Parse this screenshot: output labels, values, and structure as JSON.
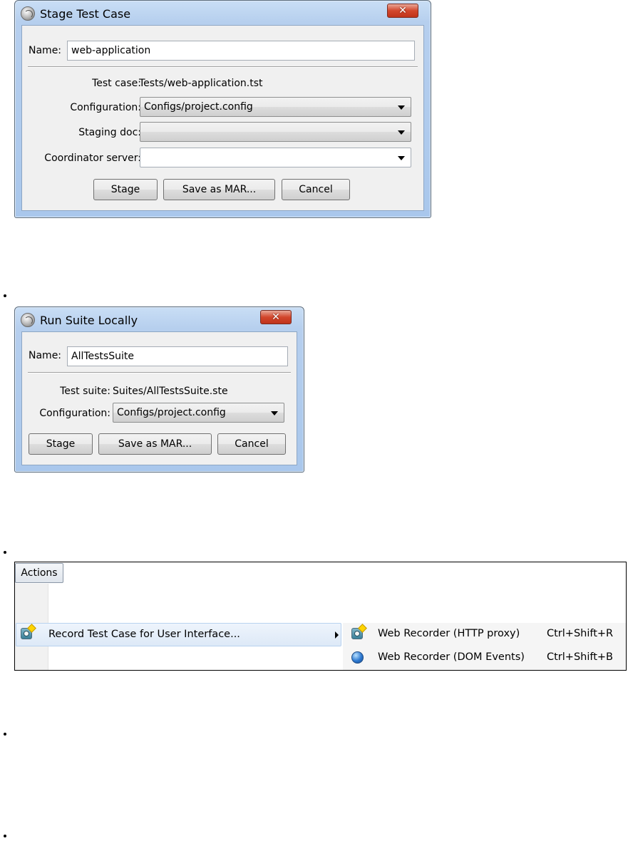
{
  "stage_dialog": {
    "title": "Stage Test Case",
    "close_label": "✕",
    "name_label": "Name:",
    "name_value": "web-application",
    "test_case_label": "Test case:",
    "test_case_value": "Tests/web-application.tst",
    "configuration_label": "Configuration:",
    "configuration_value": "Configs/project.config",
    "staging_doc_label": "Staging doc:",
    "staging_doc_value": "",
    "coordinator_label": "Coordinator server:",
    "coordinator_value": "",
    "buttons": {
      "stage": "Stage",
      "save_mar": "Save as MAR...",
      "cancel": "Cancel"
    }
  },
  "run_dialog": {
    "title": "Run Suite Locally",
    "close_label": "✕",
    "name_label": "Name:",
    "name_value": "AllTestsSuite",
    "test_suite_label": "Test suite:",
    "test_suite_value": "Suites/AllTestsSuite.ste",
    "configuration_label": "Configuration:",
    "configuration_value": "Configs/project.config",
    "buttons": {
      "stage": "Stage",
      "save_mar": "Save as MAR...",
      "cancel": "Cancel"
    }
  },
  "actions_menu": {
    "menu_label": "Actions",
    "item_label": "Record Test Case for User Interface...",
    "item_icon": "recorder-icon",
    "submenu": [
      {
        "label": "Web Recorder (HTTP proxy)",
        "shortcut": "Ctrl+Shift+R",
        "icon": "recorder-icon"
      },
      {
        "label": "Web Recorder (DOM Events)",
        "shortcut": "Ctrl+Shift+B",
        "icon": "globe-icon"
      }
    ]
  }
}
